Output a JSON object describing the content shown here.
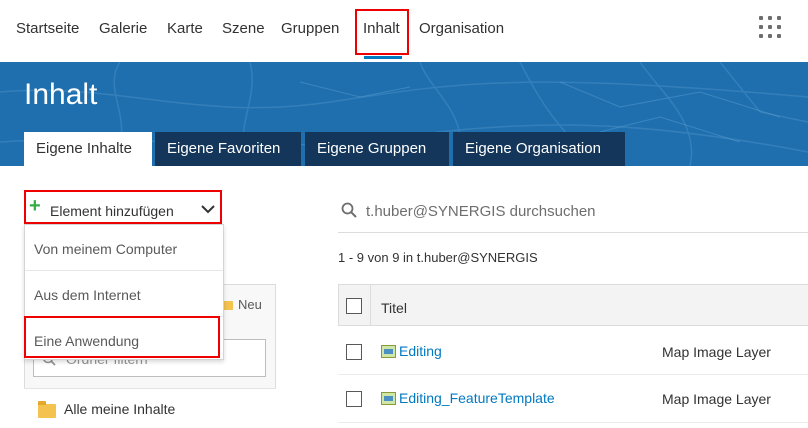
{
  "topnav": {
    "items": [
      "Startseite",
      "Galerie",
      "Karte",
      "Szene",
      "Gruppen",
      "Inhalt",
      "Organisation"
    ],
    "active": "Inhalt",
    "apps_icon": "apps-grid-icon"
  },
  "banner": {
    "title": "Inhalt",
    "tabs": [
      "Eigene Inhalte",
      "Eigene Favoriten",
      "Eigene Gruppen",
      "Eigene Organisation"
    ],
    "active_tab": "Eigene Inhalte"
  },
  "sidebar": {
    "add_item_label": "Element hinzufügen",
    "add_menu": [
      "Von meinem Computer",
      "Aus dem Internet",
      "Eine Anwendung"
    ],
    "new_folder_label": "Neu",
    "folder_filter_placeholder": "Ordner filtern",
    "all_content_label": "Alle meine Inhalte"
  },
  "main": {
    "search_placeholder": "t.huber@SYNERGIS durchsuchen",
    "results_summary": "1 - 9 von 9 in t.huber@SYNERGIS",
    "columns": {
      "title": "Titel"
    },
    "rows": [
      {
        "name": "Editing",
        "type": "Map Image Layer"
      },
      {
        "name": "Editing_FeatureTemplate",
        "type": "Map Image Layer"
      }
    ]
  },
  "colors": {
    "accent": "#0079c1",
    "banner": "#1f6fae",
    "tab_dark": "#13365a",
    "highlight": "#ee0000",
    "add_green": "#35ac46"
  }
}
